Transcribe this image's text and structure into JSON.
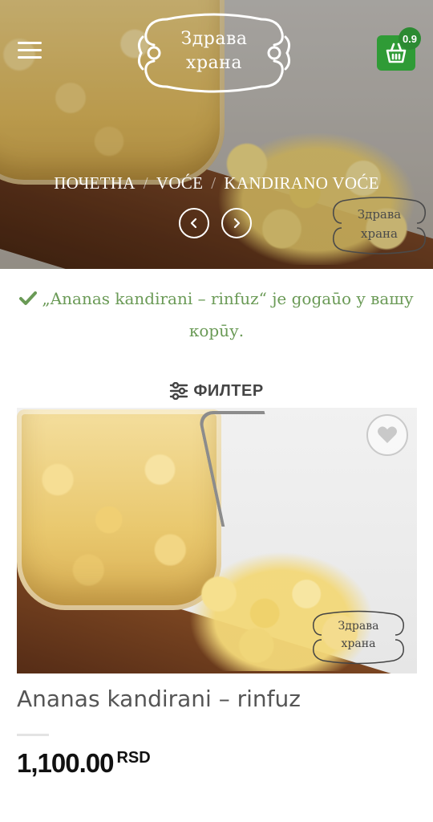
{
  "header": {
    "logo_line1": "Здрава",
    "logo_line2": "храна",
    "cart_count": "0.9",
    "colors": {
      "cart": "#2f9b36",
      "white": "#ffffff"
    }
  },
  "breadcrumb": {
    "items": [
      "ПОЧЕТНА",
      "VOĆE",
      "KANDIRANO VOĆE"
    ],
    "separator": "/"
  },
  "hero_watermark": {
    "line1": "Здрава",
    "line2": "храна"
  },
  "notice": {
    "text": "„Ananas kandirani – rinfuz“ je gogaūo y вашу корūу.",
    "color": "#6a9a56"
  },
  "filter": {
    "label": "ФИЛТЕР"
  },
  "product": {
    "title": "Ananas kandirani – rinfuz",
    "price_amount": "1,100.00",
    "price_currency": "RSD",
    "watermark_line1": "Здрава",
    "watermark_line2": "храна"
  },
  "icons": [
    "menu-icon",
    "cart-icon",
    "chevron-left-icon",
    "chevron-right-icon",
    "check-icon",
    "filter-icon",
    "heart-icon"
  ]
}
